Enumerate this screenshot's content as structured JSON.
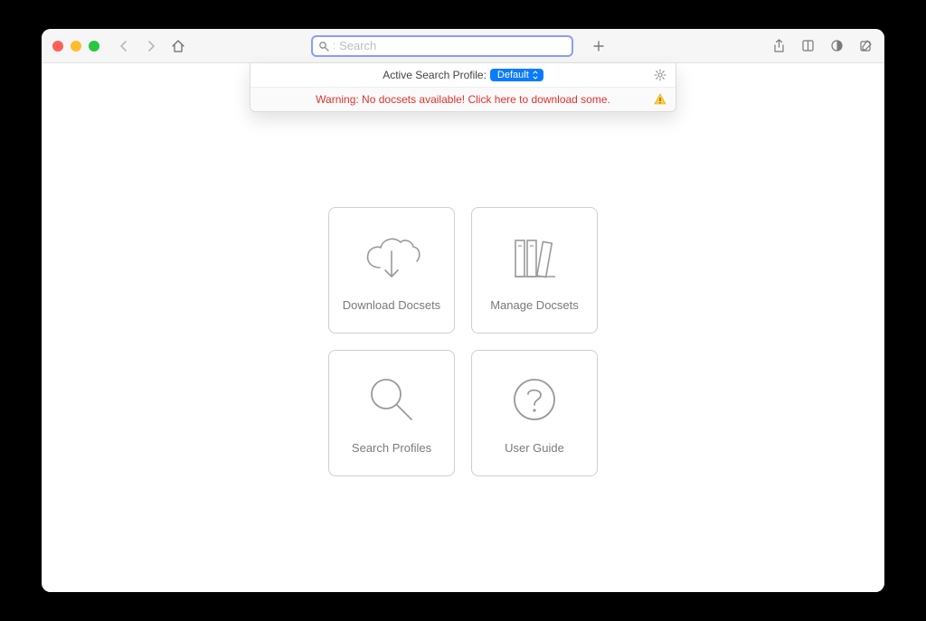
{
  "toolbar": {
    "search_placeholder": "Search"
  },
  "dropdown": {
    "profile_label": "Active Search Profile:",
    "profile_value": "Default",
    "warning_text": "Warning: No docsets available! Click here to download some."
  },
  "cards": [
    {
      "label": "Download Docsets"
    },
    {
      "label": "Manage Docsets"
    },
    {
      "label": "Search Profiles"
    },
    {
      "label": "User Guide"
    }
  ]
}
